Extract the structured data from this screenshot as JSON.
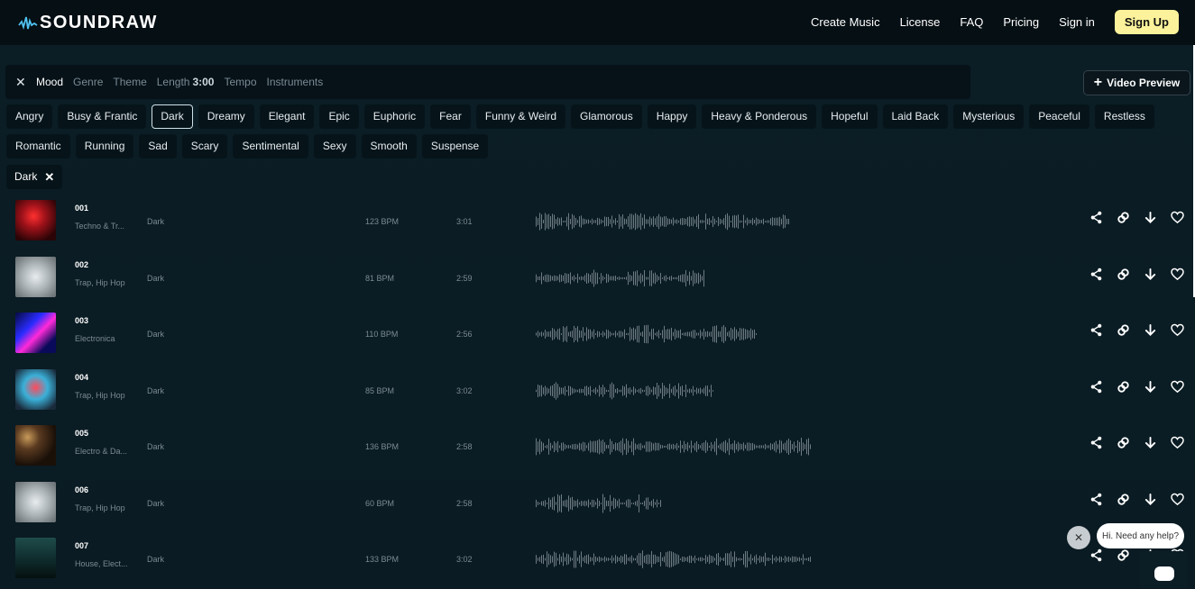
{
  "header": {
    "logo_text": "SOUNDRAW",
    "nav": [
      "Create Music",
      "License",
      "FAQ",
      "Pricing",
      "Sign in"
    ],
    "signup_label": "Sign Up"
  },
  "filterbar": {
    "close_icon": "close-icon",
    "tabs": [
      "Mood",
      "Genre",
      "Theme"
    ],
    "length_label": "Length",
    "length_value": "3:00",
    "tabs_after": [
      "Tempo",
      "Instruments"
    ],
    "video_preview_label": "Video Preview"
  },
  "moods_row1": [
    "Angry",
    "Busy & Frantic",
    "Dark",
    "Dreamy",
    "Elegant",
    "Epic",
    "Euphoric",
    "Fear",
    "Funny & Weird",
    "Glamorous",
    "Happy",
    "Heavy & Ponderous",
    "Hopeful",
    "Laid Back",
    "Mysterious",
    "Peaceful",
    "Restless"
  ],
  "moods_row2": [
    "Romantic",
    "Running",
    "Sad",
    "Scary",
    "Sentimental",
    "Sexy",
    "Smooth",
    "Suspense"
  ],
  "selected_mood": "Dark",
  "active_filter": {
    "label": "Dark"
  },
  "tracks": [
    {
      "num": "001",
      "genre": "Techno & Tr...",
      "mood": "Dark",
      "bpm": "123 BPM",
      "length": "3:01"
    },
    {
      "num": "002",
      "genre": "Trap, Hip Hop",
      "mood": "Dark",
      "bpm": "81 BPM",
      "length": "2:59"
    },
    {
      "num": "003",
      "genre": "Electronica",
      "mood": "Dark",
      "bpm": "110 BPM",
      "length": "2:56"
    },
    {
      "num": "004",
      "genre": "Trap, Hip Hop",
      "mood": "Dark",
      "bpm": "85 BPM",
      "length": "3:02"
    },
    {
      "num": "005",
      "genre": "Electro & Da...",
      "mood": "Dark",
      "bpm": "136 BPM",
      "length": "2:58"
    },
    {
      "num": "006",
      "genre": "Trap, Hip Hop",
      "mood": "Dark",
      "bpm": "60 BPM",
      "length": "2:58"
    },
    {
      "num": "007",
      "genre": "House, Elect...",
      "mood": "Dark",
      "bpm": "133 BPM",
      "length": "3:02"
    }
  ],
  "chat": {
    "bubble_text": "Hi. Need any help?"
  },
  "colors": {
    "accent": "#fbf29b",
    "background": "#0b1a22",
    "wave": "#6f7c83"
  }
}
